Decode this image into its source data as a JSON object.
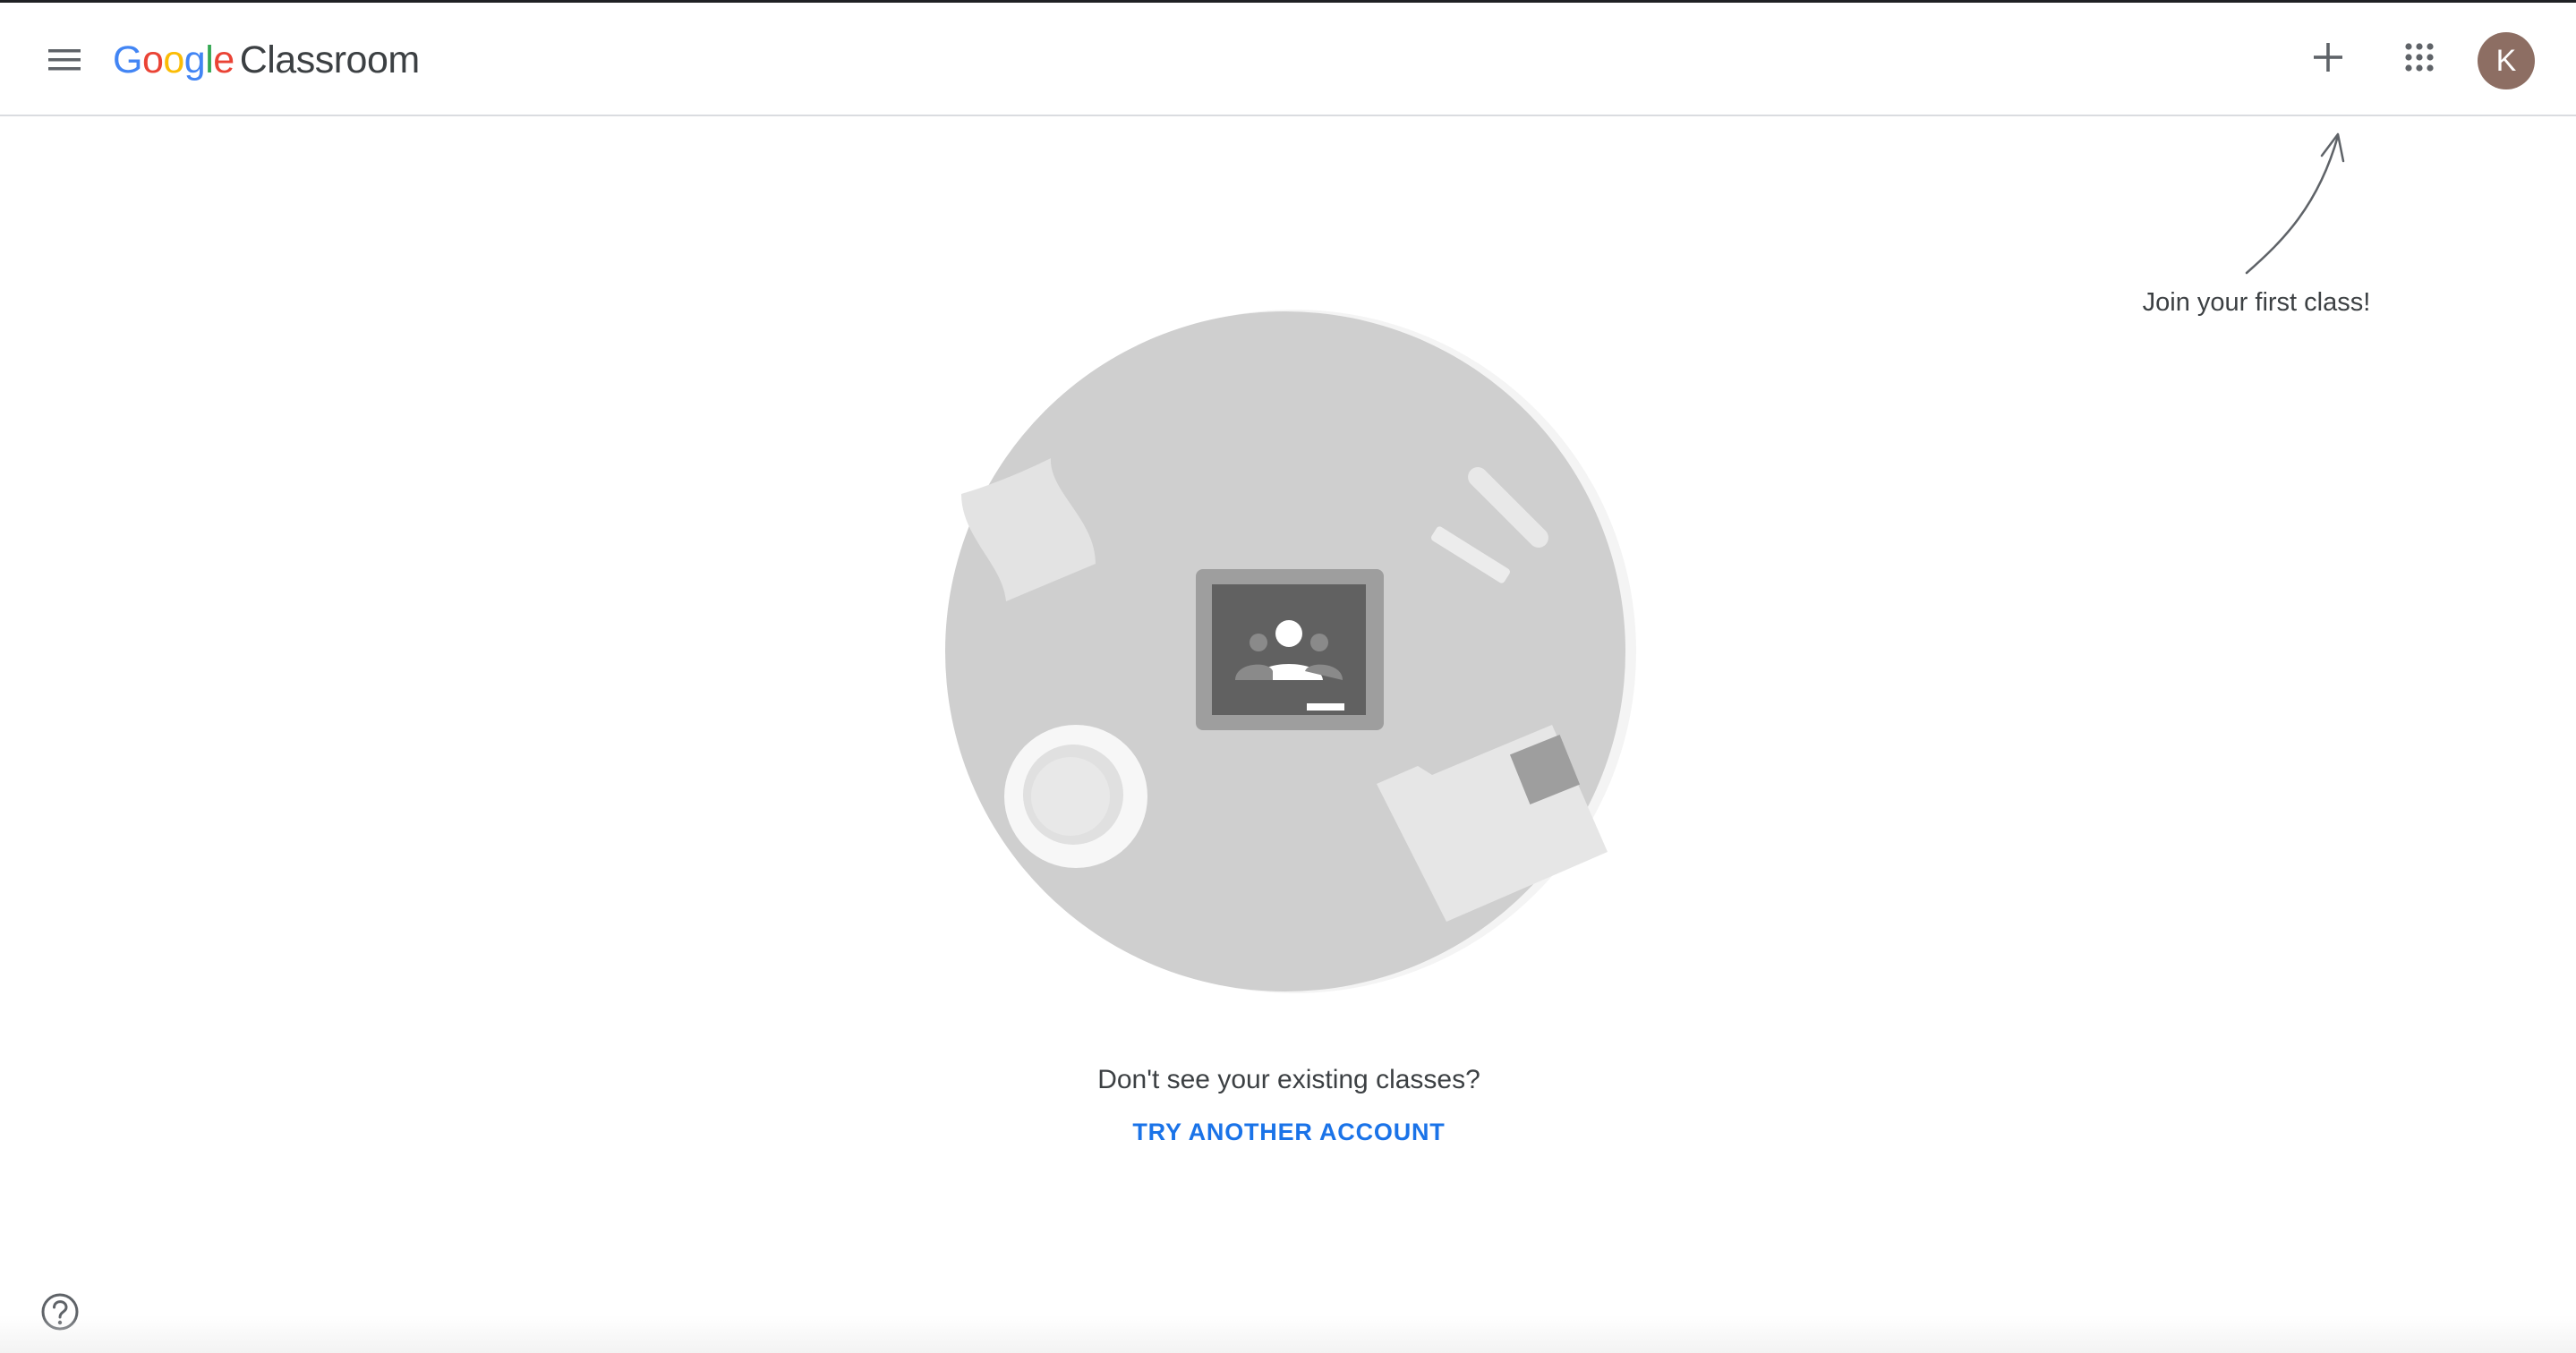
{
  "header": {
    "logo": {
      "google_letters": [
        "G",
        "o",
        "o",
        "g",
        "l",
        "e"
      ],
      "google_colors": [
        "#4285F4",
        "#EA4335",
        "#FBBC05",
        "#4285F4",
        "#34A853",
        "#EA4335"
      ],
      "product": "Classroom"
    },
    "menu_icon": "menu-icon",
    "plus_icon": "plus-icon",
    "apps_icon": "apps-grid-icon",
    "avatar": {
      "initial": "K",
      "color": "#8d6e63"
    }
  },
  "hint": {
    "text": "Join your first class!"
  },
  "empty_state": {
    "prompt": "Don't see your existing classes?",
    "link_label": "TRY ANOTHER ACCOUNT",
    "link_color": "#1a73e8"
  },
  "footer": {
    "help_icon": "help-icon"
  }
}
